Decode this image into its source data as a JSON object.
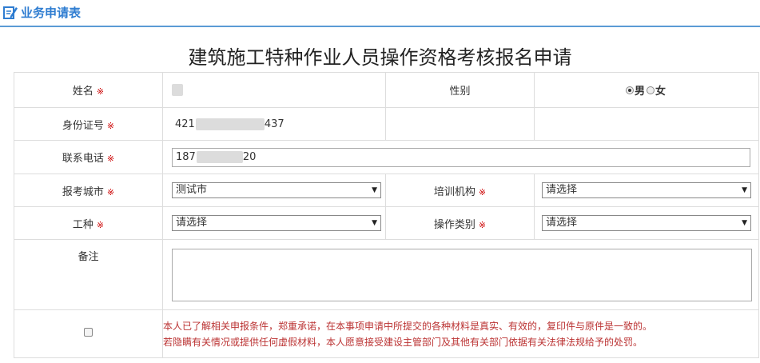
{
  "header": {
    "title": "业务申请表",
    "icon": "edit-form-icon"
  },
  "form_title": "建筑施工特种作业人员操作资格考核报名申请",
  "required_mark": "※",
  "fields": {
    "name": {
      "label": "姓名",
      "value": ""
    },
    "gender": {
      "label": "性别",
      "options": [
        "男",
        "女"
      ],
      "selected": "男"
    },
    "id_number": {
      "label": "身份证号",
      "value_prefix": "421",
      "value_suffix": "437"
    },
    "phone": {
      "label": "联系电话",
      "value_prefix": "187",
      "value_suffix": "20"
    },
    "exam_city": {
      "label": "报考城市",
      "value": "测试市"
    },
    "training_org": {
      "label": "培训机构",
      "value": "请选择"
    },
    "job_type": {
      "label": "工种",
      "value": "请选择"
    },
    "operation_category": {
      "label": "操作类别",
      "value": "请选择"
    },
    "remarks": {
      "label": "备注",
      "value": ""
    }
  },
  "declaration": {
    "line1": "本人已了解相关申报条件，郑重承诺，在本事项申请中所提交的各种材料是真实、有效的，复印件与原件是一致的。",
    "line2": "若隐瞒有关情况或提供任何虚假材料，本人愿意接受建设主管部门及其他有关部门依据有关法律法规给予的处罚。",
    "checked": false
  },
  "colors": {
    "accent": "#2f7dd1",
    "rule": "#5b9bd5",
    "required": "#cc0000",
    "declaration": "#b33333"
  }
}
